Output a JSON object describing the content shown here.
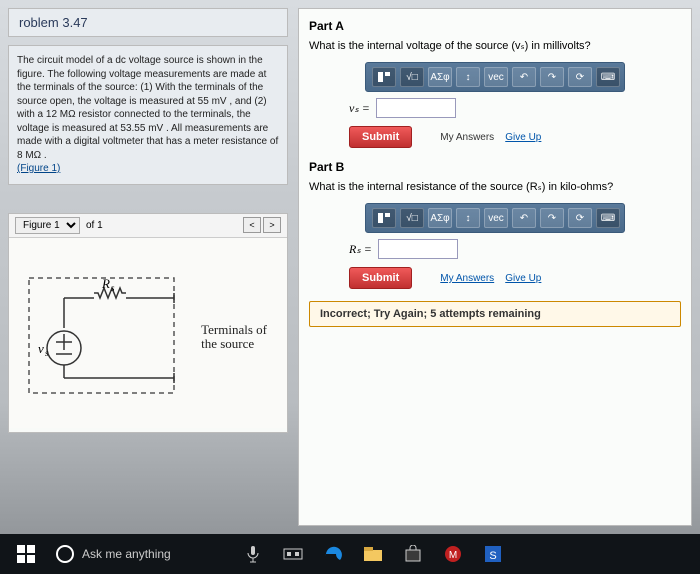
{
  "header": {
    "problem": "roblem 3.47"
  },
  "description": "The circuit model of a dc voltage source is shown in the figure. The following voltage measurements are made at the terminals of the source: (1) With the terminals of the source open, the voltage is measured at 55 mV , and (2) with a 12 MΩ resistor connected to the terminals, the voltage is measured at 53.55 mV . All measurements are made with a digital voltmeter that has a meter resistance of 8 MΩ .",
  "desc_link": "(Figure 1)",
  "figure": {
    "select": "Figure 1",
    "ofText": "of 1",
    "rs": "Rₛ",
    "vs": "vₛ",
    "terminals": "Terminals of\nthe source"
  },
  "partA": {
    "label": "Part A",
    "question": "What is the internal voltage of the source (vₛ) in millivolts?",
    "var": "vₛ =",
    "submit": "Submit",
    "myAnswers": "My Answers",
    "giveUp": "Give Up"
  },
  "partB": {
    "label": "Part B",
    "question": "What is the internal resistance of the source (Rₛ) in kilo-ohms?",
    "var": "Rₛ =",
    "submit": "Submit",
    "myAnswers": "My Answers",
    "giveUp": "Give Up",
    "feedback": "Incorrect; Try Again; 5 attempts remaining"
  },
  "toolbar": {
    "sigma": "ΑΣφ",
    "vec": "vec"
  },
  "taskbar": {
    "search": "Ask me anything"
  }
}
